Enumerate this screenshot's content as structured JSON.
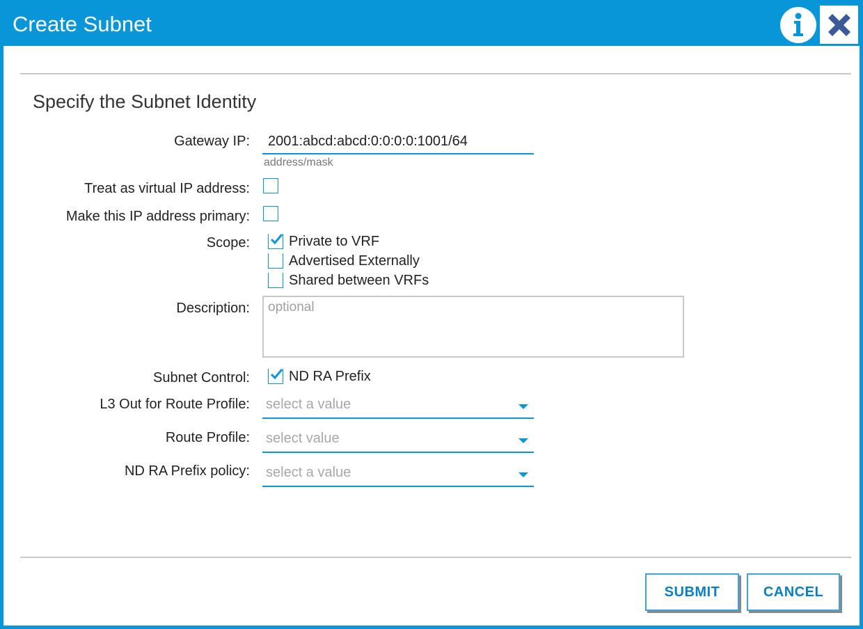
{
  "dialog": {
    "title": "Create Subnet",
    "section_title": "Specify the Subnet Identity"
  },
  "form": {
    "gateway_ip": {
      "label": "Gateway IP:",
      "value": "2001:abcd:abcd:0:0:0:0:1001/64",
      "hint": "address/mask"
    },
    "virtual_ip": {
      "label": "Treat as virtual IP address:",
      "checked": false
    },
    "primary_ip": {
      "label": "Make this IP address primary:",
      "checked": false
    },
    "scope": {
      "label": "Scope:",
      "options": [
        {
          "label": "Private to VRF",
          "checked": true
        },
        {
          "label": "Advertised Externally",
          "checked": false
        },
        {
          "label": "Shared between VRFs",
          "checked": false
        }
      ]
    },
    "description": {
      "label": "Description:",
      "placeholder": "optional",
      "value": ""
    },
    "subnet_control": {
      "label": "Subnet Control:",
      "options": [
        {
          "label": "ND RA Prefix",
          "checked": true
        }
      ]
    },
    "l3out_route_profile": {
      "label": "L3 Out for Route Profile:",
      "placeholder": "select a value"
    },
    "route_profile": {
      "label": "Route Profile:",
      "placeholder": "select value"
    },
    "nd_ra_prefix_policy": {
      "label": "ND RA Prefix policy:",
      "placeholder": "select a value"
    }
  },
  "buttons": {
    "submit": "SUBMIT",
    "cancel": "CANCEL"
  },
  "colors": {
    "accent": "#0896d8",
    "button_text": "#0a7fc0",
    "divider": "#c8c8c8"
  },
  "icons": {
    "info": "info-icon",
    "close": "close-icon",
    "check": "check-icon",
    "caret": "chevron-down-icon"
  }
}
